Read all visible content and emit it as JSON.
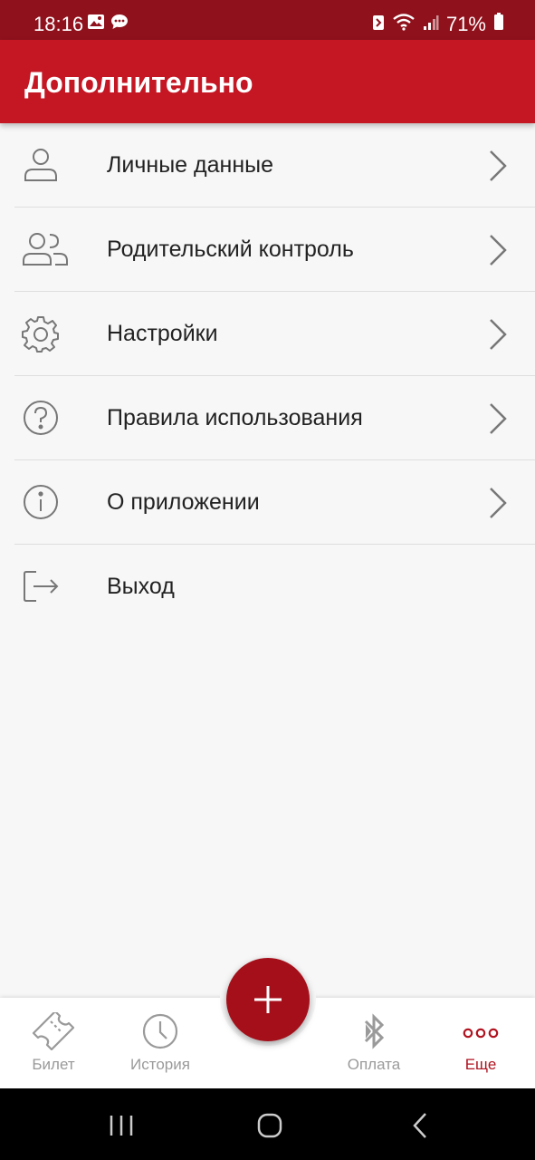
{
  "status_bar": {
    "time": "18:16",
    "battery_percent": "71%",
    "icons": [
      "image-icon",
      "chat-icon",
      "nfc-icon",
      "wifi-icon",
      "signal-icon",
      "battery-icon"
    ]
  },
  "app_bar": {
    "title": "Дополнительно"
  },
  "menu": {
    "items": [
      {
        "label": "Личные данные",
        "icon": "user-icon"
      },
      {
        "label": "Родительский контроль",
        "icon": "users-icon"
      },
      {
        "label": "Настройки",
        "icon": "gear-icon"
      },
      {
        "label": "Правила использования",
        "icon": "question-icon"
      },
      {
        "label": "О приложении",
        "icon": "info-icon"
      },
      {
        "label": "Выход",
        "icon": "logout-icon"
      }
    ]
  },
  "bottom_nav": {
    "items": [
      {
        "label": "Билет",
        "icon": "ticket-icon"
      },
      {
        "label": "История",
        "icon": "clock-icon"
      },
      {
        "label": "Оплата",
        "icon": "bluetooth-icon"
      },
      {
        "label": "Еще",
        "icon": "more-icon",
        "active": true
      }
    ],
    "fab_icon": "plus-icon"
  },
  "colors": {
    "status_bar": "#8f111c",
    "app_bar": "#c41623",
    "fab": "#a50f1a",
    "active_nav": "#b0121f",
    "inactive_nav": "#9a9a9a"
  }
}
